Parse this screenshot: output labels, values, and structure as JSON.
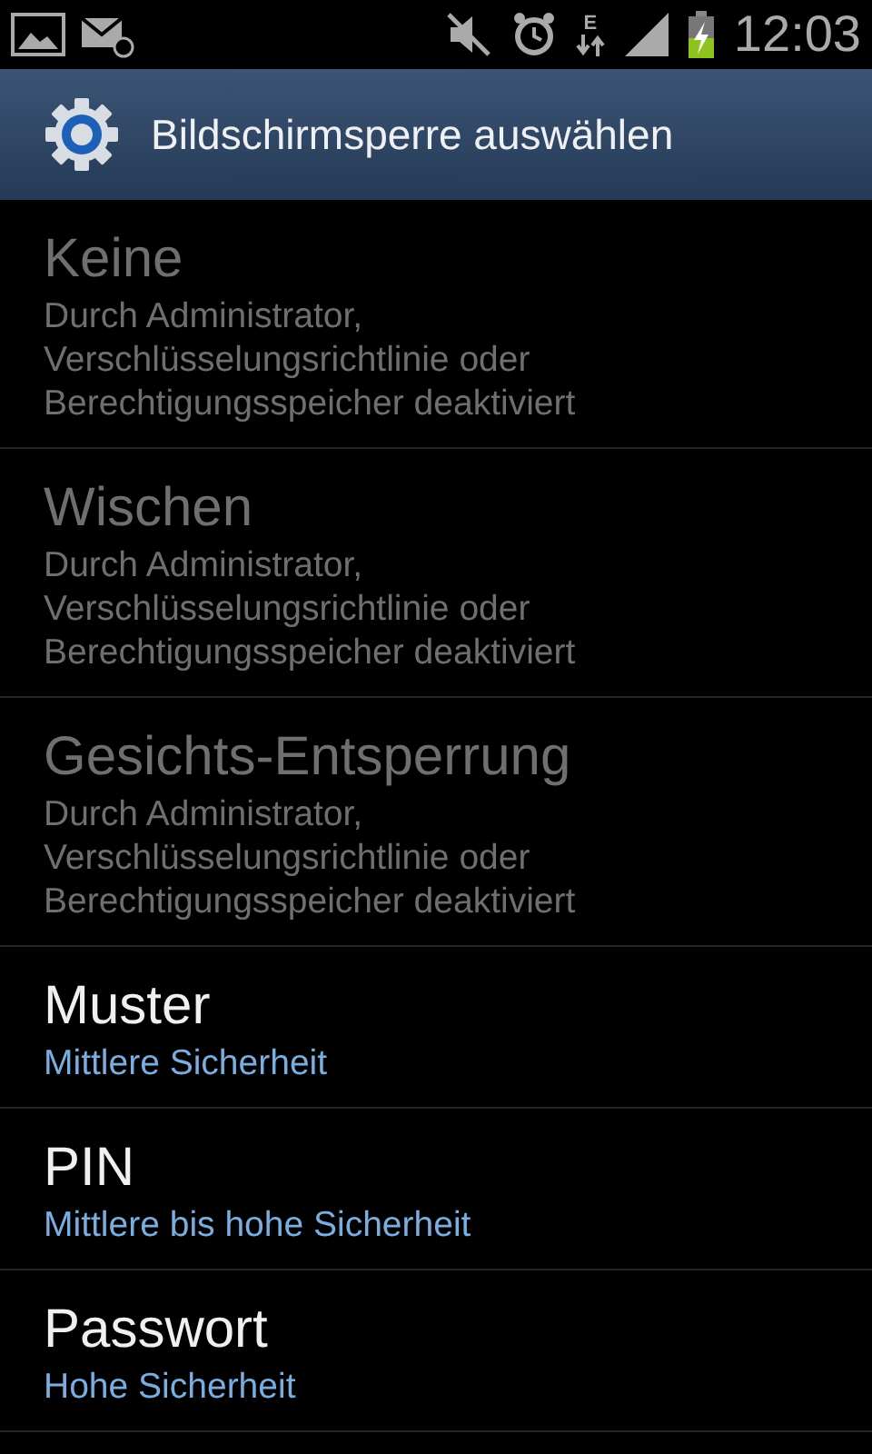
{
  "status_bar": {
    "network_type": "E",
    "time": "12:03"
  },
  "header": {
    "title": "Bildschirmsperre auswählen"
  },
  "items": [
    {
      "title": "Keine",
      "subtitle": "Durch Administrator,\nVerschlüsselungsrichtlinie oder\nBerechtigungsspeicher deaktiviert",
      "disabled": true
    },
    {
      "title": "Wischen",
      "subtitle": "Durch Administrator,\nVerschlüsselungsrichtlinie oder\nBerechtigungsspeicher deaktiviert",
      "disabled": true
    },
    {
      "title": "Gesichts-Entsperrung",
      "subtitle": "Durch Administrator,\nVerschlüsselungsrichtlinie oder\nBerechtigungsspeicher deaktiviert",
      "disabled": true
    },
    {
      "title": "Muster",
      "subtitle": "Mittlere Sicherheit",
      "disabled": false
    },
    {
      "title": "PIN",
      "subtitle": "Mittlere bis hohe Sicherheit",
      "disabled": false
    },
    {
      "title": "Passwort",
      "subtitle": "Hohe Sicherheit",
      "disabled": false
    }
  ]
}
